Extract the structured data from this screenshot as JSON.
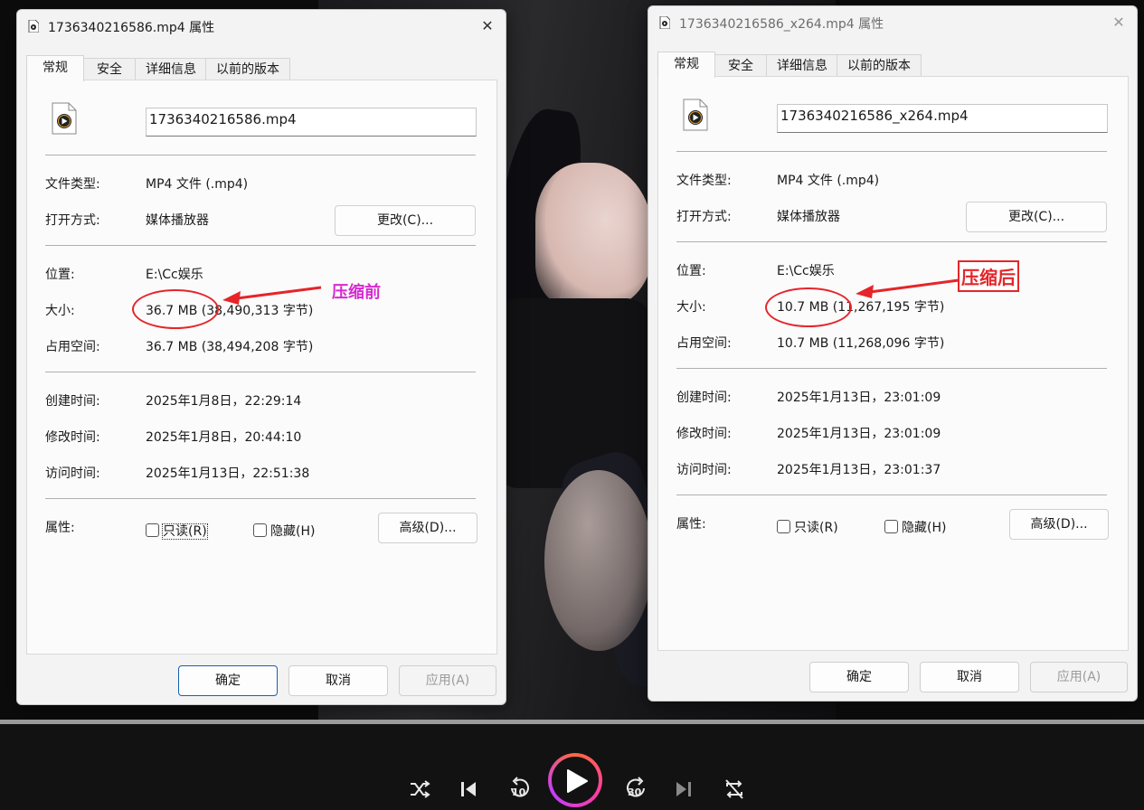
{
  "left_dialog": {
    "title": "1736340216586.mp4 属性",
    "close": "✕",
    "tabs": [
      "常规",
      "安全",
      "详细信息",
      "以前的版本"
    ],
    "filename": "1736340216586.mp4",
    "labels": {
      "type": "文件类型:",
      "open_with": "打开方式:",
      "location": "位置:",
      "size": "大小:",
      "size_on_disk": "占用空间:",
      "created": "创建时间:",
      "modified": "修改时间:",
      "accessed": "访问时间:",
      "attributes": "属性:"
    },
    "values": {
      "type": "MP4 文件 (.mp4)",
      "open_with": "媒体播放器",
      "location": "E:\\Cc娱乐",
      "size": "36.7 MB (38,490,313 字节)",
      "size_on_disk": "36.7 MB (38,494,208 字节)",
      "created": "2025年1月8日，22:29:14",
      "modified": "2025年1月8日，20:44:10",
      "accessed": "2025年1月13日，22:51:38"
    },
    "change_button": "更改(C)...",
    "readonly": "只读(R)",
    "hidden": "隐藏(H)",
    "advanced_button": "高级(D)...",
    "ok": "确定",
    "cancel": "取消",
    "apply": "应用(A)"
  },
  "right_dialog": {
    "title": "1736340216586_x264.mp4 属性",
    "close": "✕",
    "tabs": [
      "常规",
      "安全",
      "详细信息",
      "以前的版本"
    ],
    "filename": "1736340216586_x264.mp4",
    "labels": {
      "type": "文件类型:",
      "open_with": "打开方式:",
      "location": "位置:",
      "size": "大小:",
      "size_on_disk": "占用空间:",
      "created": "创建时间:",
      "modified": "修改时间:",
      "accessed": "访问时间:",
      "attributes": "属性:"
    },
    "values": {
      "type": "MP4 文件 (.mp4)",
      "open_with": "媒体播放器",
      "location": "E:\\Cc娱乐",
      "size": "10.7 MB (11,267,195 字节)",
      "size_on_disk": "10.7 MB (11,268,096 字节)",
      "created": "2025年1月13日，23:01:09",
      "modified": "2025年1月13日，23:01:09",
      "accessed": "2025年1月13日，23:01:37"
    },
    "change_button": "更改(C)...",
    "readonly": "只读(R)",
    "hidden": "隐藏(H)",
    "advanced_button": "高级(D)...",
    "ok": "确定",
    "cancel": "取消",
    "apply": "应用(A)"
  },
  "annotations": {
    "before": "压缩前",
    "after": "压缩后",
    "before_color": "#d62ad0",
    "after_color": "#e5252a"
  },
  "player": {
    "skip_back_seconds": "10",
    "skip_forward_seconds": "30",
    "icons": [
      "shuffle-icon",
      "previous-icon",
      "rewind-10-icon",
      "play-icon",
      "forward-30-icon",
      "next-icon",
      "repeat-off-icon"
    ]
  }
}
